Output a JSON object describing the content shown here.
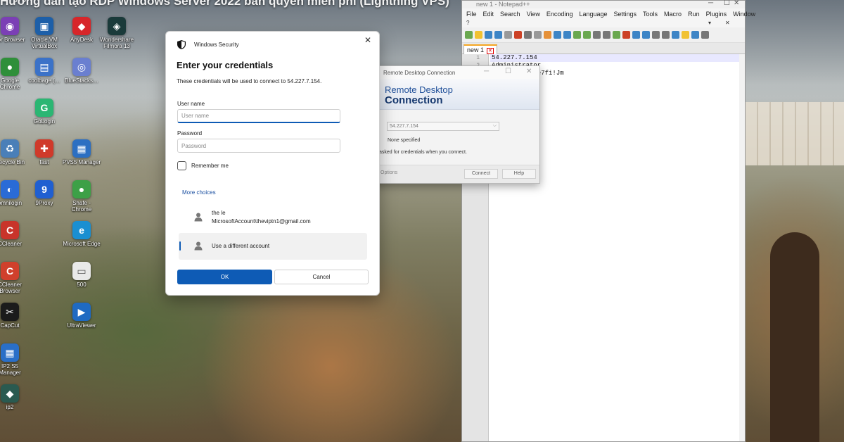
{
  "banner": {
    "title": "Hướng dẫn tạo RDP Windows Server 2022 bản quyền miễn phí (Lightning VPS)"
  },
  "desktop": {
    "icons": [
      {
        "label": "Tor Browser",
        "glyph": "◉",
        "color": "#7b3fb5"
      },
      {
        "label": "Oracle VM VirtualBox",
        "glyph": "▣",
        "color": "#1d5fa8"
      },
      {
        "label": "AnyDesk",
        "glyph": "◆",
        "color": "#d7262a"
      },
      {
        "label": "Wondershare Filmora 13",
        "glyph": "◈",
        "color": "#1a3a3a"
      },
      {
        "label": "Google Chrome",
        "glyph": "●",
        "color": "#2f8f3a"
      },
      {
        "label": "coolbage (…",
        "glyph": "▤",
        "color": "#3b72c8"
      },
      {
        "label": "BlueStacks…",
        "glyph": "◎",
        "color": "#6a7fd0"
      },
      {
        "label": "GoLogin",
        "glyph": "G",
        "color": "#2bb673"
      },
      {
        "label": "Recycle Bin",
        "glyph": "♻",
        "color": "#4a7fb8"
      },
      {
        "label": "fast",
        "glyph": "✚",
        "color": "#d03a2a"
      },
      {
        "label": "PVS5 Manager",
        "glyph": "▦",
        "color": "#2c6fc2"
      },
      {
        "label": "omnilogin",
        "glyph": "◐",
        "color": "#2a6bd6"
      },
      {
        "label": "9Proxy",
        "glyph": "9",
        "color": "#1f5fd1"
      },
      {
        "label": "Shafe - Chrome",
        "glyph": "●",
        "color": "#3da047"
      },
      {
        "label": "CCleaner",
        "glyph": "C",
        "color": "#c8342a"
      },
      {
        "label": "Microsoft Edge",
        "glyph": "e",
        "color": "#1a8fd1"
      },
      {
        "label": "CCleaner Browser",
        "glyph": "C",
        "color": "#d0402c"
      },
      {
        "label": "500",
        "glyph": "▭",
        "color": "#e9e9e9"
      },
      {
        "label": "CapCut",
        "glyph": "✂",
        "color": "#1b1b1b"
      },
      {
        "label": "UltraViewer",
        "glyph": "▶",
        "color": "#1f6ac2"
      },
      {
        "label": "IP2 S5 Manager",
        "glyph": "▦",
        "color": "#2a6fc7"
      },
      {
        "label": "ip2",
        "glyph": "◆",
        "color": "#2a5a50"
      }
    ]
  },
  "notepad": {
    "title": "new 1 - Notepad++",
    "menu": [
      "File",
      "Edit",
      "Search",
      "View",
      "Encoding",
      "Language",
      "Settings",
      "Tools",
      "Macro",
      "Run",
      "Plugins",
      "Window"
    ],
    "menu_extra": "?",
    "tab_label": "new 1",
    "lines": [
      {
        "num": "1",
        "text": "54.227.7.154"
      },
      {
        "num": "2",
        "text": "Administrator"
      },
      {
        "num": "3",
        "text": "A9FXfZV;X@pee7fi!Jm"
      }
    ]
  },
  "rdc": {
    "title": "Remote Desktop Connection",
    "banner_line1": "Remote Desktop",
    "banner_line2": "Connection",
    "computer_value": "54.227.7.154",
    "user_value": "None specified",
    "credentials_note": "asked for credentials when you connect.",
    "options_label": "Options",
    "connect_label": "Connect",
    "help_label": "Help"
  },
  "security": {
    "app_name": "Windows Security",
    "heading": "Enter your credentials",
    "subtitle": "These credentials will be used to connect to 54.227.7.154.",
    "username_label": "User name",
    "username_placeholder": "User name",
    "password_label": "Password",
    "password_placeholder": "Password",
    "remember_label": "Remember me",
    "remember_checked": false,
    "more_choices": "More choices",
    "accounts": [
      {
        "name": "the le",
        "detail": "MicrosoftAccount\\theviptn1@gmail.com"
      },
      {
        "name": "Use a different account"
      }
    ],
    "ok_label": "OK",
    "cancel_label": "Cancel",
    "accent_color": "#0e5bb5"
  }
}
